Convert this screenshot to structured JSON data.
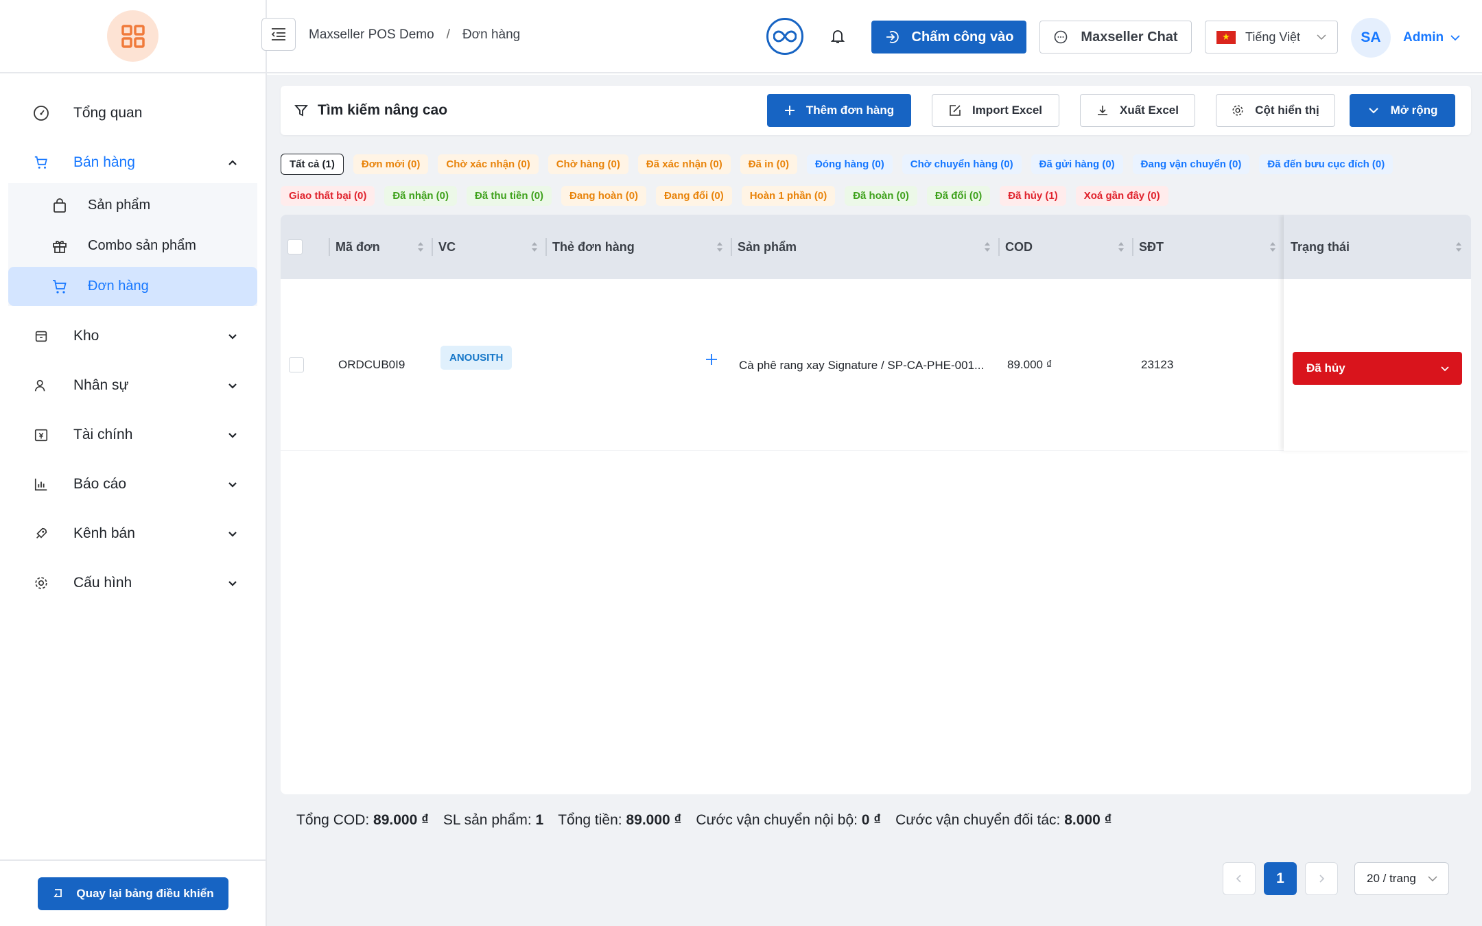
{
  "sidebar": {
    "items": [
      {
        "label": "Tổng quan",
        "icon": "dashboard-gauge-icon"
      },
      {
        "label": "Bán hàng",
        "icon": "cart-icon",
        "expanded": true,
        "children": [
          {
            "label": "Sản phẩm",
            "icon": "shopping-bag-icon"
          },
          {
            "label": "Combo sản phẩm",
            "icon": "gift-icon"
          },
          {
            "label": "Đơn hàng",
            "icon": "cart-icon",
            "active": true
          }
        ]
      },
      {
        "label": "Kho",
        "icon": "box-icon"
      },
      {
        "label": "Nhân sự",
        "icon": "users-icon"
      },
      {
        "label": "Tài chính",
        "icon": "finance-icon"
      },
      {
        "label": "Báo cáo",
        "icon": "bar-chart-icon"
      },
      {
        "label": "Kênh bán",
        "icon": "rocket-icon"
      },
      {
        "label": "Cấu hình",
        "icon": "gear-icon"
      }
    ],
    "back_label": "Quay lại bảng điều khiển"
  },
  "header": {
    "breadcrumb": [
      "Maxseller POS Demo",
      "Đơn hàng"
    ],
    "checkin_label": "Chấm công vào",
    "chat_label": "Maxseller Chat",
    "language": "Tiếng Việt",
    "avatar_initials": "SA",
    "user_name": "Admin"
  },
  "search": {
    "title": "Tìm kiếm nâng cao",
    "add_order": "Thêm đơn hàng",
    "import": "Import Excel",
    "export": "Xuất Excel",
    "columns": "Cột hiển thị",
    "expand": "Mở rộng"
  },
  "status_tabs_row1": [
    {
      "label": "Tất cả (1)",
      "style": "sel"
    },
    {
      "label": "Đơn mới (0)",
      "style": "t-orange"
    },
    {
      "label": "Chờ xác nhận (0)",
      "style": "t-orange"
    },
    {
      "label": "Chờ hàng (0)",
      "style": "t-orange"
    },
    {
      "label": "Đã xác nhận (0)",
      "style": "t-orange"
    },
    {
      "label": "Đã in (0)",
      "style": "t-orange"
    },
    {
      "label": "Đóng hàng (0)",
      "style": "t-blue"
    },
    {
      "label": "Chờ chuyển hàng (0)",
      "style": "t-blue"
    },
    {
      "label": "Đã gửi hàng (0)",
      "style": "t-blue"
    },
    {
      "label": "Đang vận chuyển (0)",
      "style": "t-blue"
    },
    {
      "label": "Đã đến bưu cục đích (0)",
      "style": "t-blue"
    }
  ],
  "status_tabs_row2": [
    {
      "label": "Giao thất bại (0)",
      "style": "t-red"
    },
    {
      "label": "Đã nhận (0)",
      "style": "t-green"
    },
    {
      "label": "Đã thu tiền (0)",
      "style": "t-green"
    },
    {
      "label": "Đang hoàn (0)",
      "style": "t-orange"
    },
    {
      "label": "Đang đổi (0)",
      "style": "t-orange"
    },
    {
      "label": "Hoàn 1 phần (0)",
      "style": "t-orange"
    },
    {
      "label": "Đã hoàn (0)",
      "style": "t-green"
    },
    {
      "label": "Đã đổi (0)",
      "style": "t-green"
    },
    {
      "label": "Đã hủy (1)",
      "style": "t-red"
    },
    {
      "label": "Xoá gần đây (0)",
      "style": "t-red"
    }
  ],
  "table": {
    "columns": [
      "Mã đơn",
      "VC",
      "Thẻ đơn hàng",
      "Sản phẩm",
      "COD",
      "SĐT",
      "Trạng thái"
    ],
    "rows": [
      {
        "order_code": "ORDCUB0I9",
        "carrier": "ANOUSITH",
        "product": "Cà phê rang xay Signature / SP-CA-PHE-001...",
        "cod": "89.000 ₫",
        "phone": "23123",
        "status": "Đã hủy"
      }
    ]
  },
  "summary": {
    "cod_label": "Tổng COD:",
    "cod_value": "89.000 ₫",
    "qty_label": "SL sản phẩm:",
    "qty_value": "1",
    "total_label": "Tổng tiền:",
    "total_value": "89.000 ₫",
    "internal_ship_label": "Cước vận chuyển nội bộ:",
    "internal_ship_value": "0 ₫",
    "partner_ship_label": "Cước vận chuyển đối tác:",
    "partner_ship_value": "8.000 ₫"
  },
  "pagination": {
    "current_page": "1",
    "page_size": "20 / trang"
  },
  "colors": {
    "primary": "#1764c3",
    "accent": "#1677ff",
    "danger": "#d9141c",
    "logo_bg": "#fde3d4",
    "logo_fg": "#f07a3a"
  }
}
